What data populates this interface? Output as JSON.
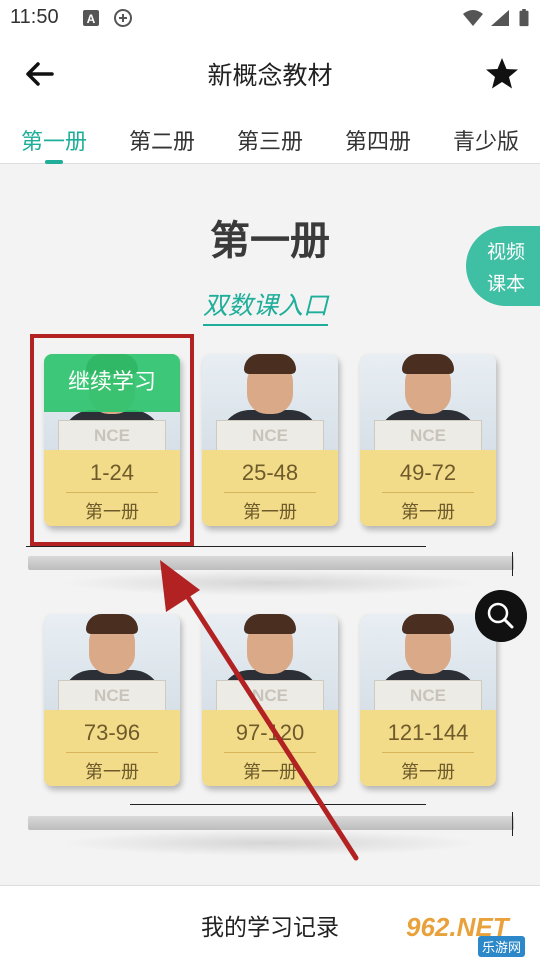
{
  "status": {
    "time": "11:50"
  },
  "header": {
    "title": "新概念教材"
  },
  "tabs": [
    "第一册",
    "第二册",
    "第三册",
    "第四册",
    "青少版"
  ],
  "active_tab": 0,
  "content": {
    "heading": "第一册",
    "entry_link": "双数课入口",
    "video_button": [
      "视频",
      "课本"
    ],
    "books": [
      {
        "range": "1-24",
        "volume": "第一册",
        "badge": "继续学习",
        "cover_text": "NCE"
      },
      {
        "range": "25-48",
        "volume": "第一册",
        "cover_text": "NCE"
      },
      {
        "range": "49-72",
        "volume": "第一册",
        "cover_text": "NCE"
      },
      {
        "range": "73-96",
        "volume": "第一册",
        "cover_text": "NCE"
      },
      {
        "range": "97-120",
        "volume": "第一册",
        "cover_text": "NCE"
      },
      {
        "range": "121-144",
        "volume": "第一册",
        "cover_text": "NCE"
      }
    ]
  },
  "bottom": {
    "label": "我的学习记录"
  },
  "watermark": {
    "main": "962.NET",
    "sub": "乐游网"
  },
  "colors": {
    "accent": "#1fae9a",
    "highlight": "#b22222",
    "badge": "#2ec46e",
    "book": "#f2dc8a"
  }
}
